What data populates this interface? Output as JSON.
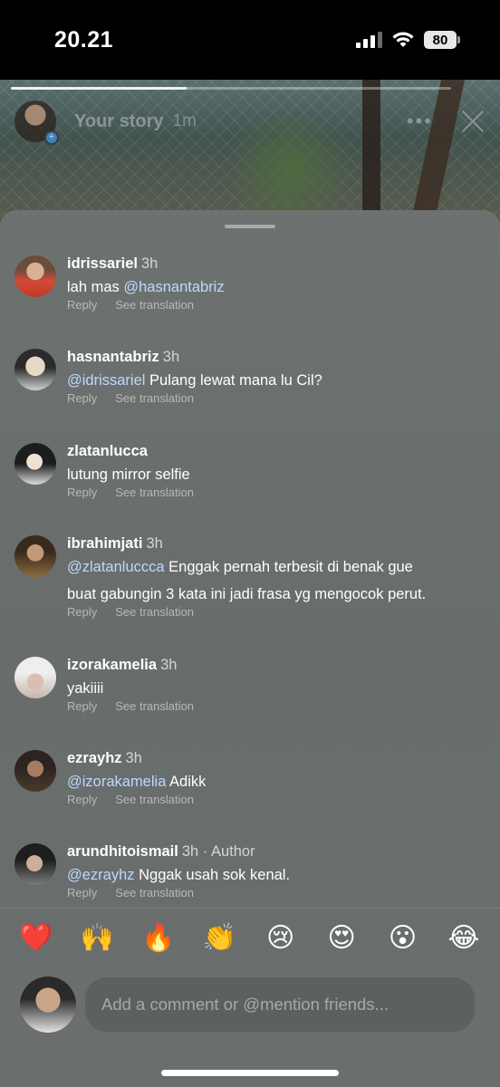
{
  "status_bar": {
    "time": "20.21",
    "battery": "80"
  },
  "story": {
    "username": "Your story",
    "time": "1m",
    "more_label": "•••"
  },
  "comments": [
    {
      "username": "idrissariel",
      "time": "3h",
      "mention": "",
      "text": "lah mas ",
      "mention_after": "@hasnantabriz",
      "reply": "Reply",
      "translate": "See translation"
    },
    {
      "username": "hasnantabriz",
      "time": "3h",
      "mention": "@idrissariel",
      "text": " Pulang lewat mana lu Cil?",
      "reply": "Reply",
      "translate": "See translation"
    },
    {
      "username": "zlatanlucca",
      "time": "",
      "mention": "",
      "text": "lutung mirror selfie",
      "reply": "Reply",
      "translate": "See translation"
    },
    {
      "username": "ibrahimjati",
      "time": "3h",
      "mention": "@zlatanluccca",
      "text": " Enggak pernah terbesit di benak gue",
      "text_line2": "buat gabungin 3 kata ini jadi frasa yg mengocok perut.",
      "reply": "Reply",
      "translate": "See translation"
    },
    {
      "username": "izorakamelia",
      "time": "3h",
      "mention": "",
      "text": "yakiiii",
      "reply": "Reply",
      "translate": "See translation"
    },
    {
      "username": "ezrayhz",
      "time": "3h",
      "mention": "@izorakamelia",
      "text": " Adikk",
      "reply": "Reply",
      "translate": "See translation"
    },
    {
      "username": "arundhitoismail",
      "time": "3h · Author",
      "mention": "@ezrayhz",
      "text": " Nggak usah sok kenal.",
      "reply": "Reply",
      "translate": "See translation"
    }
  ],
  "emoji_bar": [
    "❤️",
    "🙌",
    "🔥",
    "👏",
    "😢",
    "😍",
    "😮",
    "😂"
  ],
  "composer": {
    "placeholder": "Add a comment or @mention friends..."
  }
}
